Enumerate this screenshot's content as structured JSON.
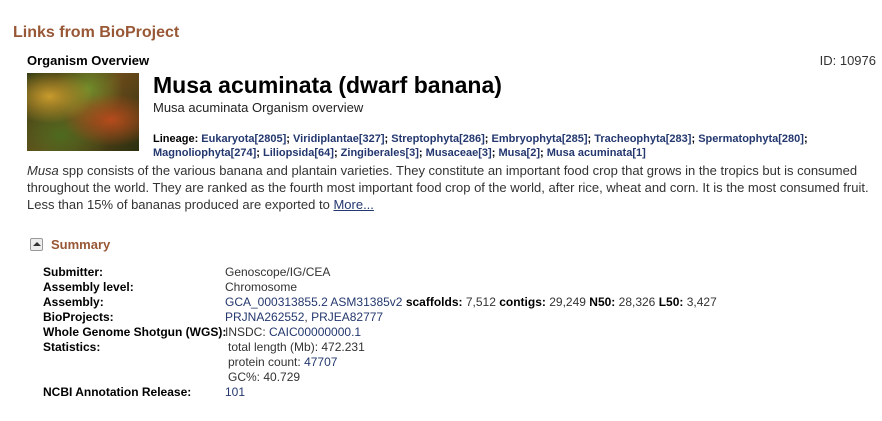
{
  "section_title": "Links from BioProject",
  "overview_label": "Organism Overview",
  "record_id": "ID: 10976",
  "organism": {
    "title": "Musa acuminata (dwarf banana)",
    "subtitle": "Musa acuminata Organism overview"
  },
  "lineage": {
    "label": "Lineage:",
    "items": [
      "Eukaryota[2805]",
      "Viridiplantae[327]",
      "Streptophyta[286]",
      "Embryophyta[285]",
      "Tracheophyta[283]",
      "Spermatophyta[280]",
      "Magnoliophyta[274]",
      "Liliopsida[64]",
      "Zingiberales[3]",
      "Musaceae[3]",
      "Musa[2]",
      "Musa acuminata[1]"
    ]
  },
  "description": {
    "genus": "Musa",
    "text": " spp consists of the various banana and plantain varieties. They constitute an important food crop that grows in the tropics but is consumed throughout the world. They are ranked as the fourth most important food crop of the world, after rice, wheat and corn. It is the most consumed fruit. Less than 15% of bananas produced are exported to ",
    "more_link": "More..."
  },
  "summary": {
    "title": "Summary",
    "submitter_label": "Submitter:",
    "submitter": "Genoscope/IG/CEA",
    "assembly_level_label": "Assembly level:",
    "assembly_level": "Chromosome",
    "assembly_label": "Assembly:",
    "assembly_link": "GCA_000313855.2 ASM31385v2",
    "scaffolds_label": "scaffolds:",
    "scaffolds": "7,512",
    "contigs_label": "contigs:",
    "contigs": "29,249",
    "n50_label": "N50:",
    "n50": "28,326",
    "l50_label": "L50:",
    "l50": "3,427",
    "bioprojects_label": "BioProjects:",
    "bioprojects": [
      "PRJNA262552",
      "PRJEA82777"
    ],
    "wgs_label": "Whole Genome Shotgun (WGS):",
    "wgs_prefix": "INSDC: ",
    "wgs_link": "CAIC00000000.1",
    "statistics_label": "Statistics:",
    "total_length_label": "total length (Mb): ",
    "total_length": "472.231",
    "protein_count_label": "protein count: ",
    "protein_count": "47707",
    "gc_label": "GC%: ",
    "gc": "40.729",
    "annotation_label": "NCBI Annotation Release:",
    "annotation": "101"
  }
}
